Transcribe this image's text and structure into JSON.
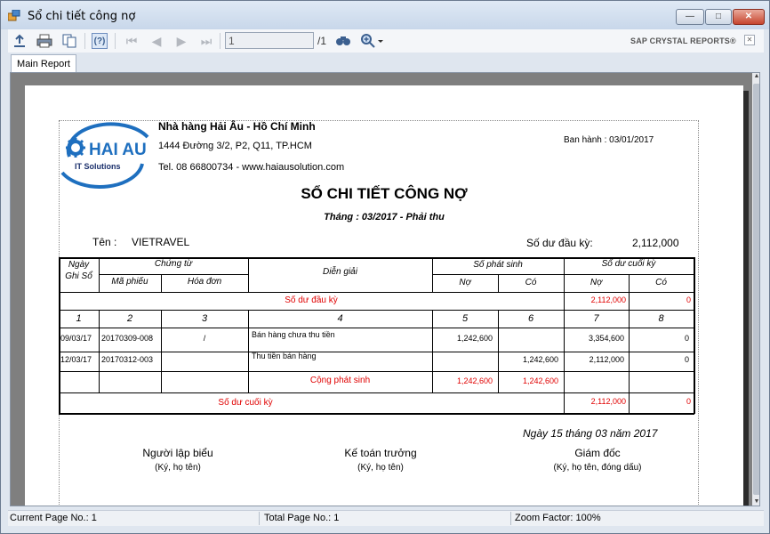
{
  "window": {
    "title": "Sổ chi tiết công nợ",
    "min_symbol": "—",
    "max_symbol": "□",
    "close_symbol": "✕"
  },
  "toolbar": {
    "page_value": "1",
    "page_total": "/1",
    "brand": "SAP CRYSTAL REPORTS®",
    "close_symbol": "✕",
    "icons": [
      "export-icon",
      "print-icon",
      "copy-icon",
      "help-icon",
      "first-page-icon",
      "previous-page-icon",
      "next-page-icon",
      "last-page-icon",
      "find-icon",
      "zoom-icon"
    ]
  },
  "tabs": {
    "main": "Main Report"
  },
  "report": {
    "logo_main": "HAI AU",
    "logo_sub": "IT Solutions",
    "company": "Nhà hàng Hải Âu - Hồ Chí Minh",
    "address": "1444 Đường 3/2, P2, Q11, TP.HCM",
    "phone": "Tel. 08 66800734 - www.haiausolution.com",
    "issued": "Ban hành : 03/01/2017",
    "title": "SỔ CHI TIẾT CÔNG NỢ",
    "subtitle": "Tháng : 03/2017 - Phải thu",
    "name_label": "Tên :",
    "name_value": "VIETRAVEL",
    "opening_label": "Số dư đầu kỳ:",
    "opening_value": "2,112,000",
    "headers": {
      "date": "Ngày",
      "date2": "Ghi Sổ",
      "voucher": "Chứng từ",
      "voucher_no": "Mã phiếu",
      "invoice": "Hóa đơn",
      "description": "Diễn giải",
      "arising": "Số phát sinh",
      "closing": "Số dư cuối kỳ",
      "debit": "Nợ",
      "credit": "Có",
      "debit2": "Nợ",
      "credit2": "Có"
    },
    "opening_row": {
      "label": "Số dư đầu kỳ",
      "debit": "2,112,000",
      "credit": "0"
    },
    "col_numbers": [
      "1",
      "2",
      "3",
      "4",
      "5",
      "6",
      "7",
      "8"
    ],
    "rows": [
      {
        "date": "09/03/17",
        "voucher": "20170309-008",
        "invoice": "/",
        "desc": "Bán hàng chưa thu tiền",
        "debit": "1,242,600",
        "credit": "",
        "bal_debit": "3,354,600",
        "bal_credit": "0"
      },
      {
        "date": "12/03/17",
        "voucher": "20170312-003",
        "invoice": "",
        "desc": "Thu tiền bán hàng",
        "debit": "",
        "credit": "1,242,600",
        "bal_debit": "2,112,000",
        "bal_credit": "0"
      }
    ],
    "total_row": {
      "label": "Cộng phát sinh",
      "debit": "1,242,600",
      "credit": "1,242,600"
    },
    "closing_row": {
      "label": "Số dư cuối kỳ",
      "debit": "2,112,000",
      "credit": "0"
    },
    "date_line": "Ngày 15 tháng 03 năm 2017",
    "signatures": [
      {
        "title": "Người lập biểu",
        "sub": "(Ký, họ tên)"
      },
      {
        "title": "Kế toán trưởng",
        "sub": "(Ký, họ tên)"
      },
      {
        "title": "Giám đốc",
        "sub": "(Ký, họ tên, đóng dấu)"
      }
    ]
  },
  "status": {
    "current_page": "Current Page No.: 1",
    "total_page": "Total Page No.: 1",
    "zoom": "Zoom Factor: 100%"
  }
}
